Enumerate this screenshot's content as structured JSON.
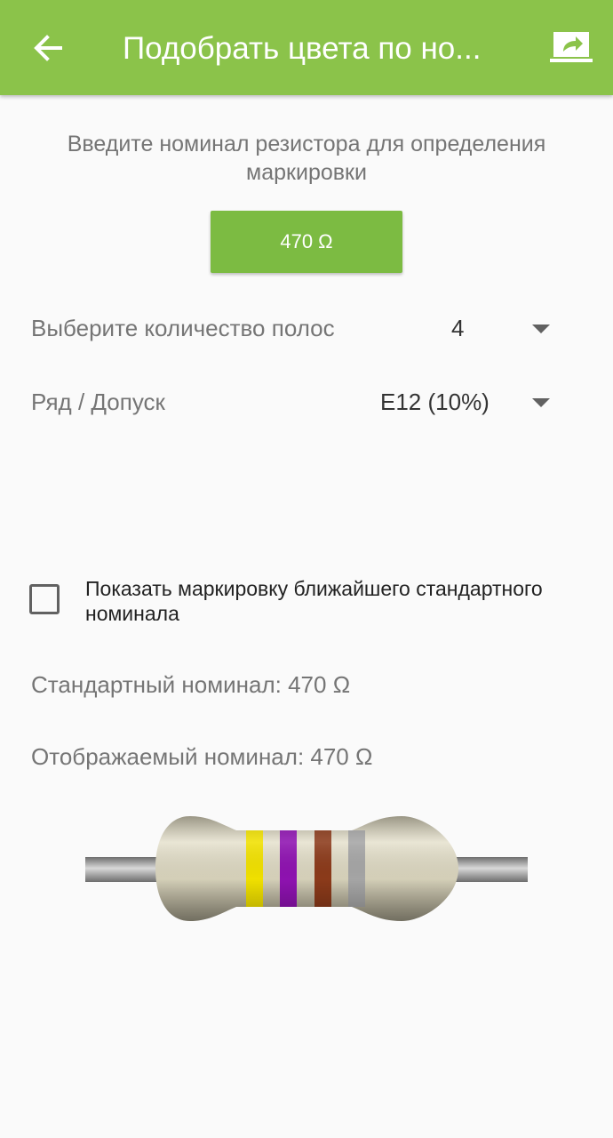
{
  "header": {
    "title": "Подобрать цвета по но...",
    "back_icon": "arrow-back-icon",
    "share_icon": "share-icon",
    "color": "#8bc34a"
  },
  "intro": {
    "text": "Введите номинал резистора для определения маркировки"
  },
  "value_button": {
    "label": "470 Ω",
    "color": "#7cbb42"
  },
  "bands_row": {
    "label": "Выберите количество полос",
    "selected": "4"
  },
  "series_row": {
    "label": "Ряд / Допуск",
    "selected": "E12 (10%)"
  },
  "checkbox": {
    "label": "Показать маркировку ближайшего стандартного номинала",
    "checked": false
  },
  "standard_value": {
    "text": "Стандартный номинал: 470 Ω"
  },
  "displayed_value": {
    "text": "Отображаемый номинал: 470 Ω"
  },
  "resistor": {
    "bands": [
      {
        "name": "yellow",
        "color": "#f0e000"
      },
      {
        "name": "violet",
        "color": "#8e12b0"
      },
      {
        "name": "brown",
        "color": "#8b3a1a"
      },
      {
        "name": "silver",
        "color": "#a5a5a5"
      }
    ]
  }
}
